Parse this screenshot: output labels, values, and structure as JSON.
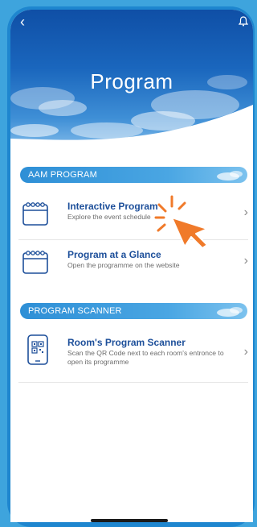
{
  "header": {
    "title": "Program",
    "back_icon": "chevron-left-icon",
    "bell_icon": "bell-icon"
  },
  "sections": [
    {
      "label": "AAM PROGRAM",
      "items": [
        {
          "title": "Interactive Program",
          "subtitle": "Explore the event schedule",
          "icon": "calendar-icon"
        },
        {
          "title": "Program at a Glance",
          "subtitle": "Open the programme on the website",
          "icon": "calendar-icon"
        }
      ]
    },
    {
      "label": "PROGRAM SCANNER",
      "items": [
        {
          "title": "Room's Program Scanner",
          "subtitle": "Scan the QR Code next to each room's entronce to open its programme",
          "icon": "qr-phone-icon"
        }
      ]
    }
  ],
  "colors": {
    "accent": "#1e86cf",
    "title_text": "#1d4f9a",
    "cursor": "#f07a2a"
  }
}
